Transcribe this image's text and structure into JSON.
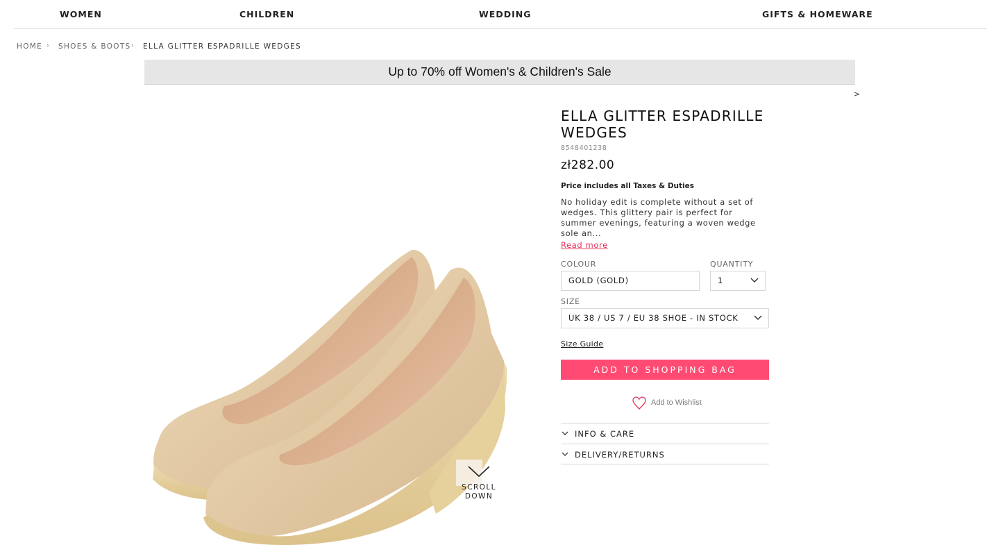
{
  "nav": {
    "items": [
      {
        "label": "WOMEN"
      },
      {
        "label": "CHILDREN"
      },
      {
        "label": "WEDDING"
      },
      {
        "label": "GIFTS & HOMEWARE"
      }
    ]
  },
  "breadcrumb": {
    "items": [
      "HOME",
      "SHOES & BOOTS",
      "ELLA GLITTER ESPADRILLE WEDGES"
    ],
    "separator": "›"
  },
  "promo": {
    "text": "Up to 70% off Women's & Children's Sale",
    "next_label": ">"
  },
  "product": {
    "title": "ELLA GLITTER ESPADRILLE WEDGES",
    "sku": "8548401238",
    "price": "zł282.00",
    "tax_note": "Price includes all Taxes & Duties",
    "description": "No holiday edit is complete without a set of wedges. This glittery pair is perfect for summer evenings, featuring a woven wedge sole an...",
    "read_more": "Read more",
    "image_icon": "shoe-pair-image"
  },
  "options": {
    "colour_label": "COLOUR",
    "colour_value": "GOLD (GOLD)",
    "quantity_label": "QUANTITY",
    "quantity_value": "1",
    "size_label": "SIZE",
    "size_value": "UK 38 / US 7 / EU 38 SHOE - IN STOCK"
  },
  "actions": {
    "size_guide": "Size Guide",
    "add_to_bag": "ADD TO SHOPPING BAG",
    "wishlist": "Add to Wishlist",
    "wishlist_icon": "heart-icon"
  },
  "accordion": {
    "items": [
      {
        "label": "INFO & CARE"
      },
      {
        "label": "DELIVERY/RETURNS"
      }
    ]
  },
  "scroll_hint": {
    "label": "SCROLL DOWN",
    "icon": "chevron-down-icon"
  },
  "colors": {
    "accent": "#ff4b73",
    "link": "#e8305a",
    "banner_bg": "#e6e6e6"
  }
}
